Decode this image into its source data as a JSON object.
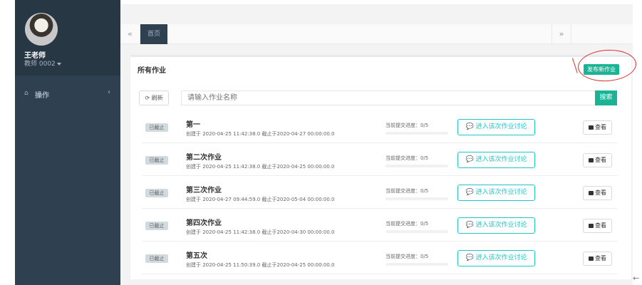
{
  "sidebar": {
    "user_name": "王老师",
    "user_role": "教师 0002",
    "nav": [
      {
        "label": "操作",
        "icon": "home-icon"
      }
    ]
  },
  "tabs": {
    "left_arrow": "«",
    "home": "首页",
    "right_arrow": "»"
  },
  "panel": {
    "title": "所有作业",
    "publish_label": "发布新作业",
    "refresh_label": "刷新",
    "search_placeholder": "请输入作业名称",
    "search_label": "搜索"
  },
  "assignments": [
    {
      "status": "已截止",
      "title": "第一",
      "meta": "创建于 2020-04-25 11:42:38.0 截止于2020-04-27 00:00:00.0",
      "progress_label": "当前提交进度：0/5",
      "progress": 0,
      "discuss_label": "进入该次作业讨论",
      "view_label": "查看"
    },
    {
      "status": "已截止",
      "title": "第二次作业",
      "meta": "创建于 2020-04-25 11:42:38.0 截止于2020-04-25 00:00:00.0",
      "progress_label": "当前提交进度：0/5",
      "progress": 0,
      "discuss_label": "进入该次作业讨论",
      "view_label": "查看"
    },
    {
      "status": "已截止",
      "title": "第三次作业",
      "meta": "创建于 2020-04-27 09:44:59.0 截止于2020-05-04 00:00:00.0",
      "progress_label": "当前提交进度：0/5",
      "progress": 0,
      "discuss_label": "进入该次作业讨论",
      "view_label": "查看"
    },
    {
      "status": "已截止",
      "title": "第四次作业",
      "meta": "创建于 2020-04-25 11:42:38.0 截止于2020-04-30 00:00:00.0",
      "progress_label": "当前提交进度：0/5",
      "progress": 0,
      "discuss_label": "进入该次作业讨论",
      "view_label": "查看"
    },
    {
      "status": "已截止",
      "title": "第五次",
      "meta": "创建于 2020-04-25 11:50:39.0 截止于2020-04-25 00:00:00.0",
      "progress_label": "当前提交进度：0/5",
      "progress": 0,
      "discuss_label": "进入该次作业讨论",
      "view_label": "查看"
    }
  ],
  "colors": {
    "sidebar": "#2f4050",
    "primary": "#1ab394",
    "info": "#23c6c8",
    "annotation": "#d93030"
  }
}
